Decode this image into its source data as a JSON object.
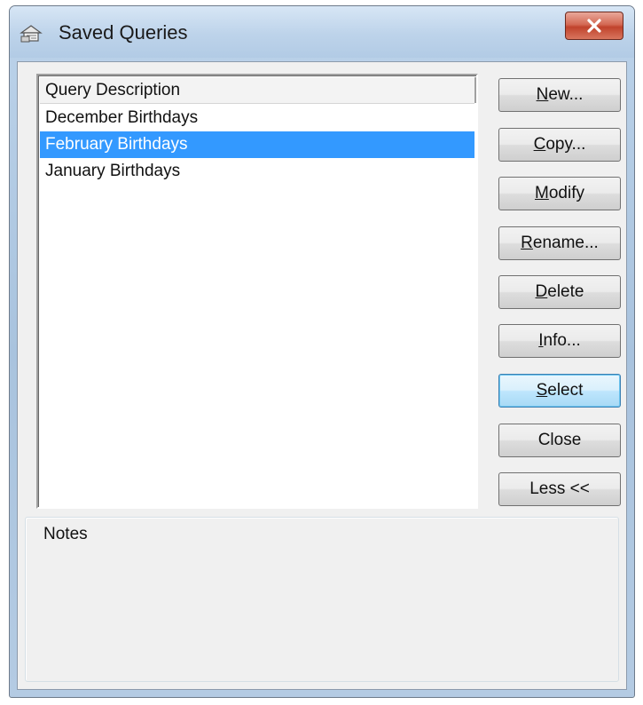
{
  "window": {
    "title": "Saved Queries",
    "icon": "saved-queries-icon",
    "close_icon": "close-x-icon"
  },
  "list": {
    "column_header": "Query Description",
    "rows": [
      {
        "label": "December Birthdays",
        "selected": false
      },
      {
        "label": "February Birthdays",
        "selected": true
      },
      {
        "label": "January Birthdays",
        "selected": false
      }
    ]
  },
  "buttons": {
    "new": {
      "accel": "N",
      "rest": "ew..."
    },
    "copy": {
      "accel": "C",
      "rest": "opy..."
    },
    "modify": {
      "accel": "M",
      "rest": "odify"
    },
    "rename": {
      "accel": "R",
      "rest": "ename..."
    },
    "delete": {
      "accel": "D",
      "rest": "elete"
    },
    "info": {
      "accel": "I",
      "rest": "nfo..."
    },
    "select": {
      "accel": "S",
      "rest": "elect"
    },
    "close": {
      "label": "Close"
    },
    "less": {
      "label": "Less <<"
    }
  },
  "notes": {
    "label": "Notes"
  },
  "colors": {
    "selection": "#3399ff",
    "close_button": "#c0432c"
  }
}
